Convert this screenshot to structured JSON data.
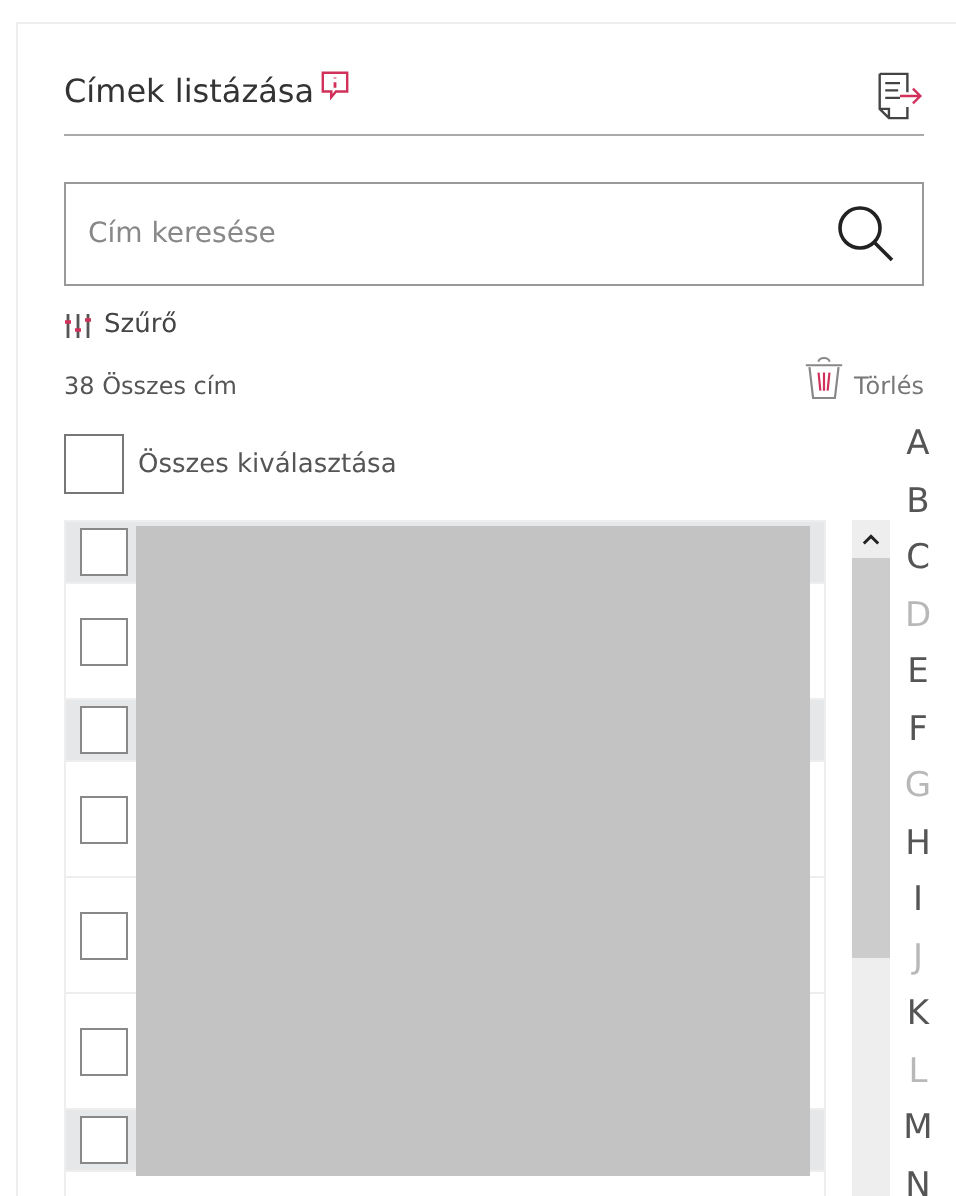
{
  "header": {
    "title": "Címek listázása"
  },
  "search": {
    "placeholder": "Cím keresése"
  },
  "filter": {
    "label": "Szűrő"
  },
  "count": "38 Összes cím",
  "delete": {
    "label": "Törlés"
  },
  "select_all": {
    "label": "Összes kiválasztása",
    "checked": false
  },
  "rows": [
    {
      "kind": "group",
      "checked": false
    },
    {
      "kind": "item",
      "checked": false
    },
    {
      "kind": "group",
      "checked": false
    },
    {
      "kind": "item",
      "checked": false
    },
    {
      "kind": "item",
      "checked": false
    },
    {
      "kind": "item",
      "checked": false
    },
    {
      "kind": "group",
      "checked": false
    }
  ],
  "alphabet": [
    {
      "letter": "A",
      "disabled": false
    },
    {
      "letter": "B",
      "disabled": false
    },
    {
      "letter": "C",
      "disabled": false
    },
    {
      "letter": "D",
      "disabled": true
    },
    {
      "letter": "E",
      "disabled": false
    },
    {
      "letter": "F",
      "disabled": false
    },
    {
      "letter": "G",
      "disabled": true
    },
    {
      "letter": "H",
      "disabled": false
    },
    {
      "letter": "I",
      "disabled": false
    },
    {
      "letter": "J",
      "disabled": true
    },
    {
      "letter": "K",
      "disabled": false
    },
    {
      "letter": "L",
      "disabled": true
    },
    {
      "letter": "M",
      "disabled": false
    },
    {
      "letter": "N",
      "disabled": false
    }
  ]
}
